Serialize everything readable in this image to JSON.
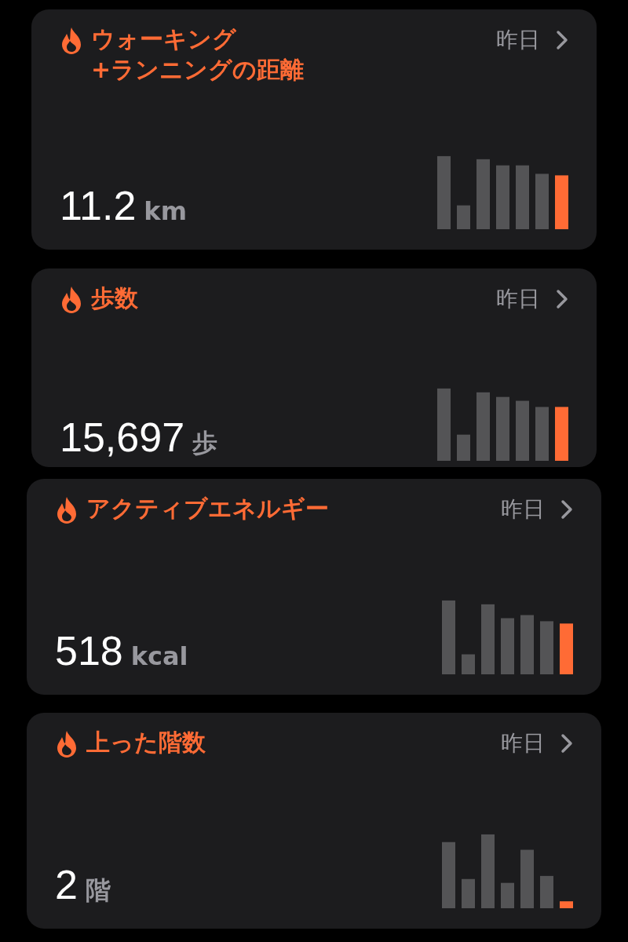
{
  "cards": [
    {
      "title": "ウォーキング\n+ランニングの距離",
      "period": "昨日",
      "value": "11.2",
      "unit": "km",
      "bars": [
        {
          "highlighted": false
        },
        {
          "highlighted": false
        },
        {
          "highlighted": false
        },
        {
          "highlighted": false
        },
        {
          "highlighted": false
        },
        {
          "highlighted": false
        },
        {
          "highlighted": true
        }
      ]
    },
    {
      "title": "歩数",
      "period": "昨日",
      "value": "15,697",
      "unit": "歩",
      "bars": [
        {
          "highlighted": false
        },
        {
          "highlighted": false
        },
        {
          "highlighted": false
        },
        {
          "highlighted": false
        },
        {
          "highlighted": false
        },
        {
          "highlighted": false
        },
        {
          "highlighted": true
        }
      ]
    },
    {
      "title": "アクティブエネルギー",
      "period": "昨日",
      "value": "518",
      "unit": "kcal",
      "bars": [
        {
          "highlighted": false
        },
        {
          "highlighted": false
        },
        {
          "highlighted": false
        },
        {
          "highlighted": false
        },
        {
          "highlighted": false
        },
        {
          "highlighted": false
        },
        {
          "highlighted": true
        }
      ]
    },
    {
      "title": "上った階数",
      "period": "昨日",
      "value": "2",
      "unit": "階",
      "bars": [
        {
          "highlighted": false
        },
        {
          "highlighted": false
        },
        {
          "highlighted": false
        },
        {
          "highlighted": false
        },
        {
          "highlighted": false
        },
        {
          "highlighted": false
        },
        {
          "highlighted": true
        }
      ]
    }
  ]
}
